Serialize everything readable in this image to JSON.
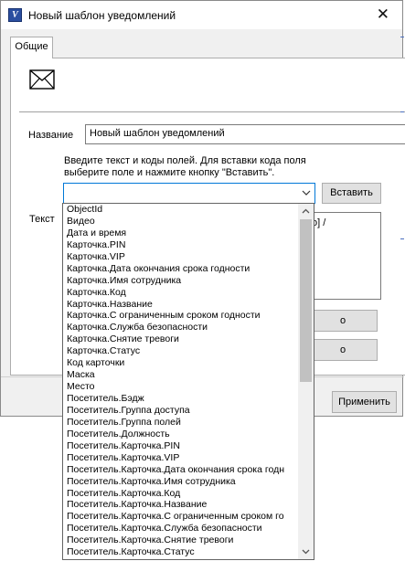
{
  "window": {
    "title": "Новый шаблон уведомлений",
    "close_glyph": "✕"
  },
  "tabs": [
    {
      "label": "Общие"
    }
  ],
  "form": {
    "name_label": "Название",
    "name_value": "Новый шаблон уведомлений",
    "hint": "Введите текст и коды полей. Для вставки кода поля выберите поле и нажмите кнопку \"Вставить\".",
    "text_label": "Текст",
    "insert_button": "Вставить",
    "text_area_partial": "о] /",
    "side_button1_partial": "о",
    "side_button2_partial": "о",
    "apply_button": "Применить"
  },
  "dropdown": {
    "items": [
      "ObjectId",
      "Видео",
      "Дата и время",
      "Карточка.PIN",
      "Карточка.VIP",
      "Карточка.Дата окончания срока годности",
      "Карточка.Имя сотрудника",
      "Карточка.Код",
      "Карточка.Название",
      "Карточка.С ограниченным сроком годности",
      "Карточка.Служба безопасности",
      "Карточка.Снятие тревоги",
      "Карточка.Статус",
      "Код карточки",
      "Маска",
      "Место",
      "Посетитель.Бэдж",
      "Посетитель.Группа доступа",
      "Посетитель.Группа полей",
      "Посетитель.Должность",
      "Посетитель.Карточка.PIN",
      "Посетитель.Карточка.VIP",
      "Посетитель.Карточка.Дата окончания срока годн",
      "Посетитель.Карточка.Имя сотрудника",
      "Посетитель.Карточка.Код",
      "Посетитель.Карточка.Название",
      "Посетитель.Карточка.С ограниченным сроком го",
      "Посетитель.Карточка.Служба безопасности",
      "Посетитель.Карточка.Снятие тревоги",
      "Посетитель.Карточка.Статус"
    ]
  },
  "icons": {
    "app": "app-icon",
    "envelope": "envelope-icon",
    "close": "close-icon",
    "dropdown_arrow": "chevron-down-icon",
    "scroll_up": "chevron-up-icon",
    "scroll_down": "chevron-down-icon"
  },
  "colors": {
    "focus_border": "#0078d7",
    "window_bg": "#f0f0f0"
  }
}
